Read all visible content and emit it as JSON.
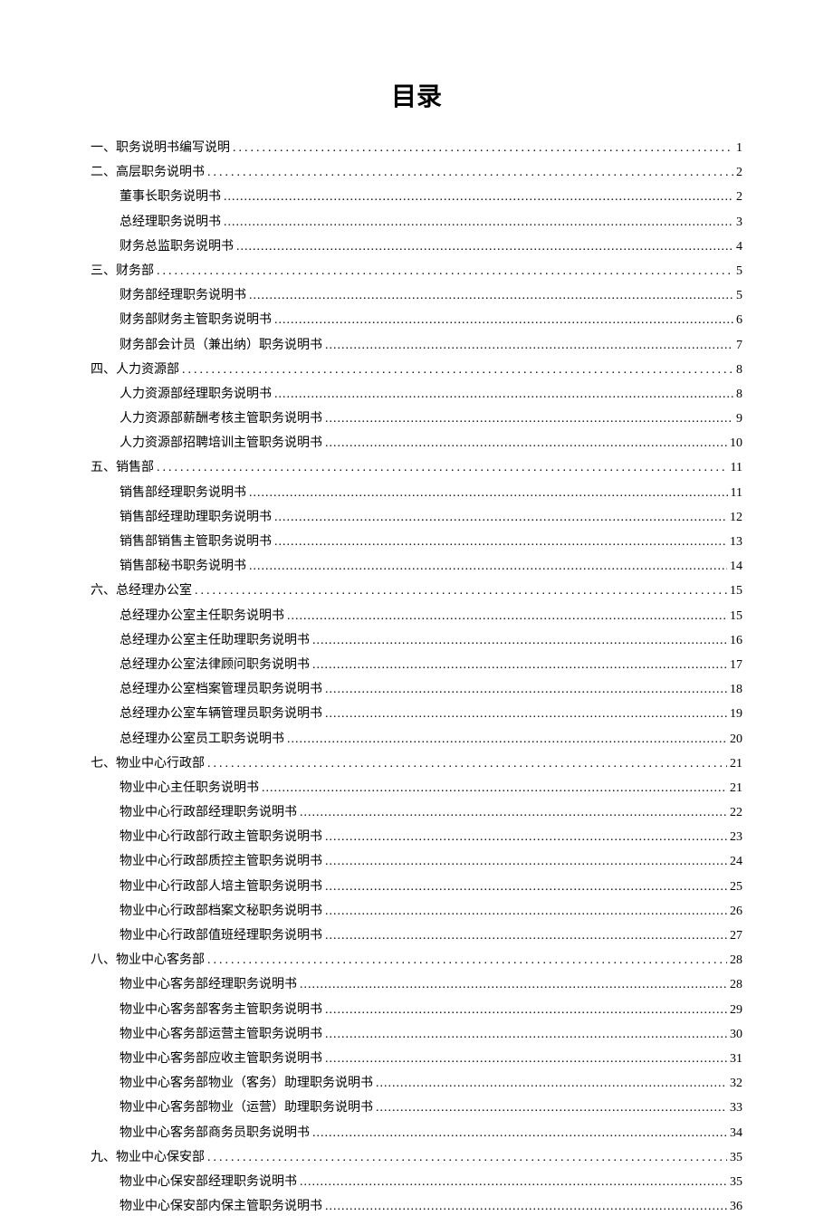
{
  "title": "目录",
  "entries": [
    {
      "level": 1,
      "label": "一、职务说明书编写说明",
      "page": "1"
    },
    {
      "level": 1,
      "label": "二、高层职务说明书",
      "page": "2"
    },
    {
      "level": 2,
      "label": "董事长职务说明书",
      "page": "2"
    },
    {
      "level": 2,
      "label": "总经理职务说明书",
      "page": "3"
    },
    {
      "level": 2,
      "label": "财务总监职务说明书",
      "page": "4"
    },
    {
      "level": 1,
      "label": "三、财务部",
      "page": "5"
    },
    {
      "level": 2,
      "label": "财务部经理职务说明书",
      "page": "5"
    },
    {
      "level": 2,
      "label": "财务部财务主管职务说明书",
      "page": "6"
    },
    {
      "level": 2,
      "label": "财务部会计员（兼出纳）职务说明书",
      "page": "7"
    },
    {
      "level": 1,
      "label": "四、人力资源部",
      "page": "8"
    },
    {
      "level": 2,
      "label": "人力资源部经理职务说明书",
      "page": "8"
    },
    {
      "level": 2,
      "label": "人力资源部薪酬考核主管职务说明书",
      "page": "9"
    },
    {
      "level": 2,
      "label": "人力资源部招聘培训主管职务说明书",
      "page": "10"
    },
    {
      "level": 1,
      "label": "五、销售部",
      "page": "11"
    },
    {
      "level": 2,
      "label": "销售部经理职务说明书",
      "page": "11"
    },
    {
      "level": 2,
      "label": "销售部经理助理职务说明书",
      "page": "12"
    },
    {
      "level": 2,
      "label": "销售部销售主管职务说明书",
      "page": "13"
    },
    {
      "level": 2,
      "label": "销售部秘书职务说明书",
      "page": "14"
    },
    {
      "level": 1,
      "label": "六、总经理办公室",
      "page": "15"
    },
    {
      "level": 2,
      "label": "总经理办公室主任职务说明书",
      "page": "15"
    },
    {
      "level": 2,
      "label": "总经理办公室主任助理职务说明书",
      "page": "16"
    },
    {
      "level": 2,
      "label": "总经理办公室法律顾问职务说明书",
      "page": "17"
    },
    {
      "level": 2,
      "label": "总经理办公室档案管理员职务说明书",
      "page": "18"
    },
    {
      "level": 2,
      "label": "总经理办公室车辆管理员职务说明书",
      "page": "19"
    },
    {
      "level": 2,
      "label": "总经理办公室员工职务说明书",
      "page": "20"
    },
    {
      "level": 1,
      "label": "七、物业中心行政部",
      "page": "21"
    },
    {
      "level": 2,
      "label": "物业中心主任职务说明书",
      "page": "21"
    },
    {
      "level": 2,
      "label": "物业中心行政部经理职务说明书",
      "page": "22"
    },
    {
      "level": 2,
      "label": "物业中心行政部行政主管职务说明书",
      "page": "23"
    },
    {
      "level": 2,
      "label": "物业中心行政部质控主管职务说明书",
      "page": "24"
    },
    {
      "level": 2,
      "label": "物业中心行政部人培主管职务说明书",
      "page": "25"
    },
    {
      "level": 2,
      "label": "物业中心行政部档案文秘职务说明书",
      "page": "26"
    },
    {
      "level": 2,
      "label": "物业中心行政部值班经理职务说明书",
      "page": "27"
    },
    {
      "level": 1,
      "label": "八、物业中心客务部",
      "page": "28"
    },
    {
      "level": 2,
      "label": "物业中心客务部经理职务说明书",
      "page": "28"
    },
    {
      "level": 2,
      "label": "物业中心客务部客务主管职务说明书",
      "page": "29"
    },
    {
      "level": 2,
      "label": "物业中心客务部运营主管职务说明书",
      "page": "30"
    },
    {
      "level": 2,
      "label": "物业中心客务部应收主管职务说明书",
      "page": "31"
    },
    {
      "level": 2,
      "label": "物业中心客务部物业（客务）助理职务说明书",
      "page": "32"
    },
    {
      "level": 2,
      "label": "物业中心客务部物业（运营）助理职务说明书",
      "page": "33"
    },
    {
      "level": 2,
      "label": "物业中心客务部商务员职务说明书",
      "page": "34"
    },
    {
      "level": 1,
      "label": "九、物业中心保安部",
      "page": "35"
    },
    {
      "level": 2,
      "label": "物业中心保安部经理职务说明书",
      "page": "35"
    },
    {
      "level": 2,
      "label": "物业中心保安部内保主管职务说明书",
      "page": "36"
    }
  ]
}
